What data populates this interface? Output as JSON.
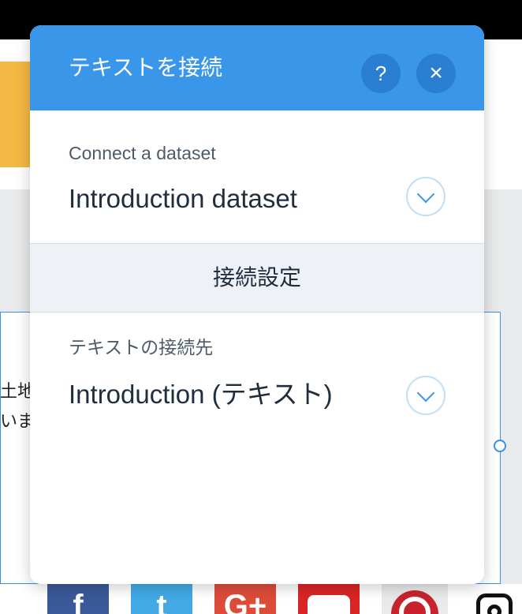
{
  "panel": {
    "title": "テキストを接続",
    "help_label": "?",
    "close_label": "×"
  },
  "dataset": {
    "label": "Connect a dataset",
    "value": "Introduction dataset"
  },
  "connection_settings": {
    "header": "接続設定",
    "text_connect_label": "テキストの接続先",
    "text_connect_value": "Introduction (テキスト)"
  },
  "background": {
    "line1": "土地",
    "line2": "いま"
  },
  "social": {
    "facebook": "f",
    "twitter": "t",
    "googleplus": "G+"
  },
  "colors": {
    "header": "#3a96e8",
    "accent": "#3a91e6",
    "facebook": "#3b5998",
    "twitter": "#42a9e5",
    "googleplus": "#dd4b39",
    "youtube": "#d92525",
    "pinterest": "#c8232c"
  }
}
